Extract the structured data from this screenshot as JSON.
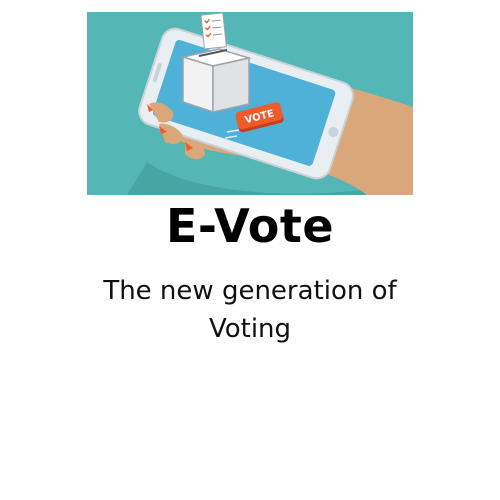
{
  "hero": {
    "button_label": "VOTE",
    "colors": {
      "background": "#54b6b5",
      "skin": "#d9a779",
      "phone": "#e9eef2",
      "screen": "#4fb0d8",
      "ballot_box": "#f2f2f2",
      "vote_button": "#f15a2b"
    }
  },
  "title": "E-Vote",
  "tagline": {
    "line1": "The new generation of",
    "line2": "Voting"
  }
}
